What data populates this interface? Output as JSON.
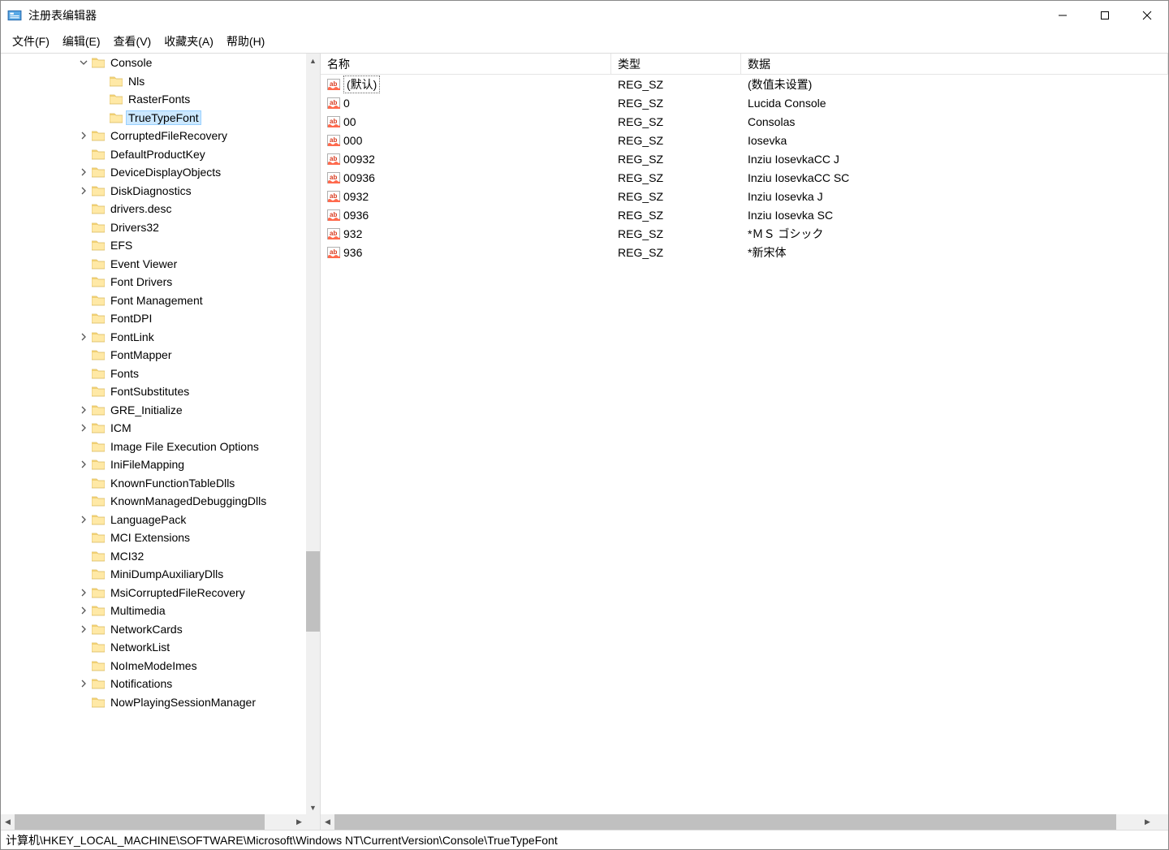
{
  "window": {
    "title": "注册表编辑器"
  },
  "menu": {
    "file": "文件(F)",
    "edit": "编辑(E)",
    "view": "查看(V)",
    "favorites": "收藏夹(A)",
    "help": "帮助(H)"
  },
  "tree": [
    {
      "indent": 4,
      "expander": "open",
      "label": "Console"
    },
    {
      "indent": 5,
      "expander": "none",
      "label": "Nls"
    },
    {
      "indent": 5,
      "expander": "none",
      "label": "RasterFonts"
    },
    {
      "indent": 5,
      "expander": "none",
      "label": "TrueTypeFont",
      "selected": true
    },
    {
      "indent": 4,
      "expander": "closed",
      "label": "CorruptedFileRecovery"
    },
    {
      "indent": 4,
      "expander": "none",
      "label": "DefaultProductKey"
    },
    {
      "indent": 4,
      "expander": "closed",
      "label": "DeviceDisplayObjects"
    },
    {
      "indent": 4,
      "expander": "closed",
      "label": "DiskDiagnostics"
    },
    {
      "indent": 4,
      "expander": "none",
      "label": "drivers.desc"
    },
    {
      "indent": 4,
      "expander": "none",
      "label": "Drivers32"
    },
    {
      "indent": 4,
      "expander": "none",
      "label": "EFS"
    },
    {
      "indent": 4,
      "expander": "none",
      "label": "Event Viewer"
    },
    {
      "indent": 4,
      "expander": "none",
      "label": "Font Drivers"
    },
    {
      "indent": 4,
      "expander": "none",
      "label": "Font Management"
    },
    {
      "indent": 4,
      "expander": "none",
      "label": "FontDPI"
    },
    {
      "indent": 4,
      "expander": "closed",
      "label": "FontLink"
    },
    {
      "indent": 4,
      "expander": "none",
      "label": "FontMapper"
    },
    {
      "indent": 4,
      "expander": "none",
      "label": "Fonts"
    },
    {
      "indent": 4,
      "expander": "none",
      "label": "FontSubstitutes"
    },
    {
      "indent": 4,
      "expander": "closed",
      "label": "GRE_Initialize"
    },
    {
      "indent": 4,
      "expander": "closed",
      "label": "ICM"
    },
    {
      "indent": 4,
      "expander": "none",
      "label": "Image File Execution Options"
    },
    {
      "indent": 4,
      "expander": "closed",
      "label": "IniFileMapping"
    },
    {
      "indent": 4,
      "expander": "none",
      "label": "KnownFunctionTableDlls"
    },
    {
      "indent": 4,
      "expander": "none",
      "label": "KnownManagedDebuggingDlls"
    },
    {
      "indent": 4,
      "expander": "closed",
      "label": "LanguagePack"
    },
    {
      "indent": 4,
      "expander": "none",
      "label": "MCI Extensions"
    },
    {
      "indent": 4,
      "expander": "none",
      "label": "MCI32"
    },
    {
      "indent": 4,
      "expander": "none",
      "label": "MiniDumpAuxiliaryDlls"
    },
    {
      "indent": 4,
      "expander": "closed",
      "label": "MsiCorruptedFileRecovery"
    },
    {
      "indent": 4,
      "expander": "closed",
      "label": "Multimedia"
    },
    {
      "indent": 4,
      "expander": "closed",
      "label": "NetworkCards"
    },
    {
      "indent": 4,
      "expander": "none",
      "label": "NetworkList"
    },
    {
      "indent": 4,
      "expander": "none",
      "label": "NoImeModeImes"
    },
    {
      "indent": 4,
      "expander": "closed",
      "label": "Notifications"
    },
    {
      "indent": 4,
      "expander": "none",
      "label": "NowPlayingSessionManager"
    }
  ],
  "columns": {
    "name": "名称",
    "type": "类型",
    "data": "数据"
  },
  "values": [
    {
      "name": "(默认)",
      "type": "REG_SZ",
      "data": "(数值未设置)",
      "default": true
    },
    {
      "name": "0",
      "type": "REG_SZ",
      "data": "Lucida Console"
    },
    {
      "name": "00",
      "type": "REG_SZ",
      "data": "Consolas"
    },
    {
      "name": "000",
      "type": "REG_SZ",
      "data": "Iosevka"
    },
    {
      "name": "00932",
      "type": "REG_SZ",
      "data": "Inziu IosevkaCC J"
    },
    {
      "name": "00936",
      "type": "REG_SZ",
      "data": "Inziu IosevkaCC SC"
    },
    {
      "name": "0932",
      "type": "REG_SZ",
      "data": "Inziu Iosevka J"
    },
    {
      "name": "0936",
      "type": "REG_SZ",
      "data": "Inziu Iosevka SC"
    },
    {
      "name": "932",
      "type": "REG_SZ",
      "data": "*ＭＳ ゴシック"
    },
    {
      "name": "936",
      "type": "REG_SZ",
      "data": "*新宋体"
    }
  ],
  "statusbar": "计算机\\HKEY_LOCAL_MACHINE\\SOFTWARE\\Microsoft\\Windows NT\\CurrentVersion\\Console\\TrueTypeFont"
}
